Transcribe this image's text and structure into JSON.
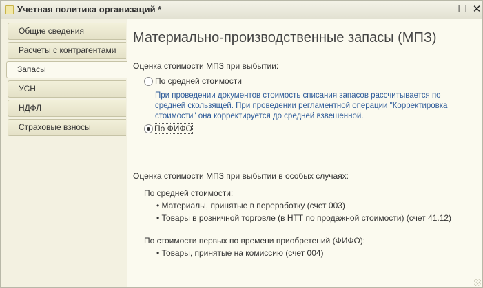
{
  "window": {
    "title": "Учетная политика организаций *",
    "minimize_glyph": "_",
    "maximize_glyph": "☐",
    "close_glyph": "✕"
  },
  "sidebar": {
    "items": [
      {
        "label": "Общие сведения"
      },
      {
        "label": "Расчеты с контрагентами"
      },
      {
        "label": "Запасы"
      },
      {
        "label": "УСН"
      },
      {
        "label": "НДФЛ"
      },
      {
        "label": "Страховые взносы"
      }
    ],
    "active_index": 2
  },
  "main": {
    "title": "Материально-производственные запасы (МПЗ)",
    "valuation_label": "Оценка стоимости МПЗ при выбытии:",
    "options": [
      {
        "label": "По средней стоимости",
        "selected": false
      },
      {
        "label": "По ФИФО",
        "selected": true
      }
    ],
    "hint": "При проведении документов стоимость списания запасов рассчитывается по средней скользящей. При проведении регламентной операции \"Корректировка стоимости\" она корректируется до средней взвешенной.",
    "special_label": "Оценка стоимости МПЗ при выбытии в  особых случаях:",
    "avg_group_label": "По средней стоимости:",
    "avg_items": [
      "Материалы, принятые в переработку (счет 003)",
      "Товары в розничной торговле (в НТТ по продажной стоимости) (счет 41.12)"
    ],
    "fifo_group_label": "По стоимости первых по времени приобретений (ФИФО):",
    "fifo_items": [
      "Товары, принятые на комиссию (счет 004)"
    ]
  }
}
